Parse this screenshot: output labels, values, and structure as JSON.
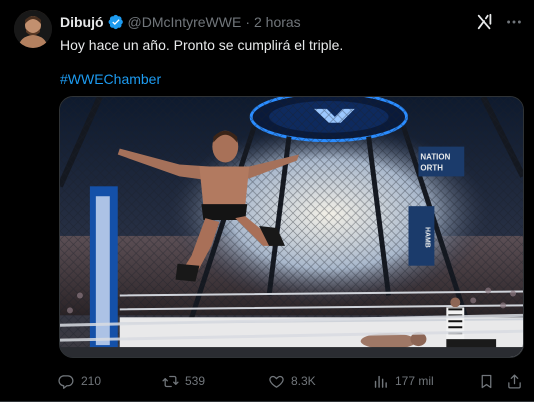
{
  "tweet": {
    "display_name": "Dibujó",
    "handle": "@DMcIntyreWWE",
    "separator": "·",
    "time": "2 horas",
    "text": "Hoy hace un año. Pronto se cumplirá el triple.",
    "hashtag": "#WWEChamber"
  },
  "media": {
    "signage_1": "NATION",
    "signage_2": "ORTH",
    "signage_3": "HAMB"
  },
  "actions": {
    "replies": "210",
    "reposts": "539",
    "likes": "8.3K",
    "views": "177 mil"
  },
  "colors": {
    "background": "#000000",
    "text": "#e7e9ea",
    "muted": "#71767b",
    "accent": "#1d9bf0"
  },
  "icons": {
    "verified": "verified-badge-icon",
    "grok": "grok-icon",
    "more": "more-dots-icon",
    "reply": "reply-icon",
    "repost": "repost-icon",
    "like": "heart-icon",
    "views": "views-chart-icon",
    "bookmark": "bookmark-icon",
    "share": "share-icon"
  }
}
